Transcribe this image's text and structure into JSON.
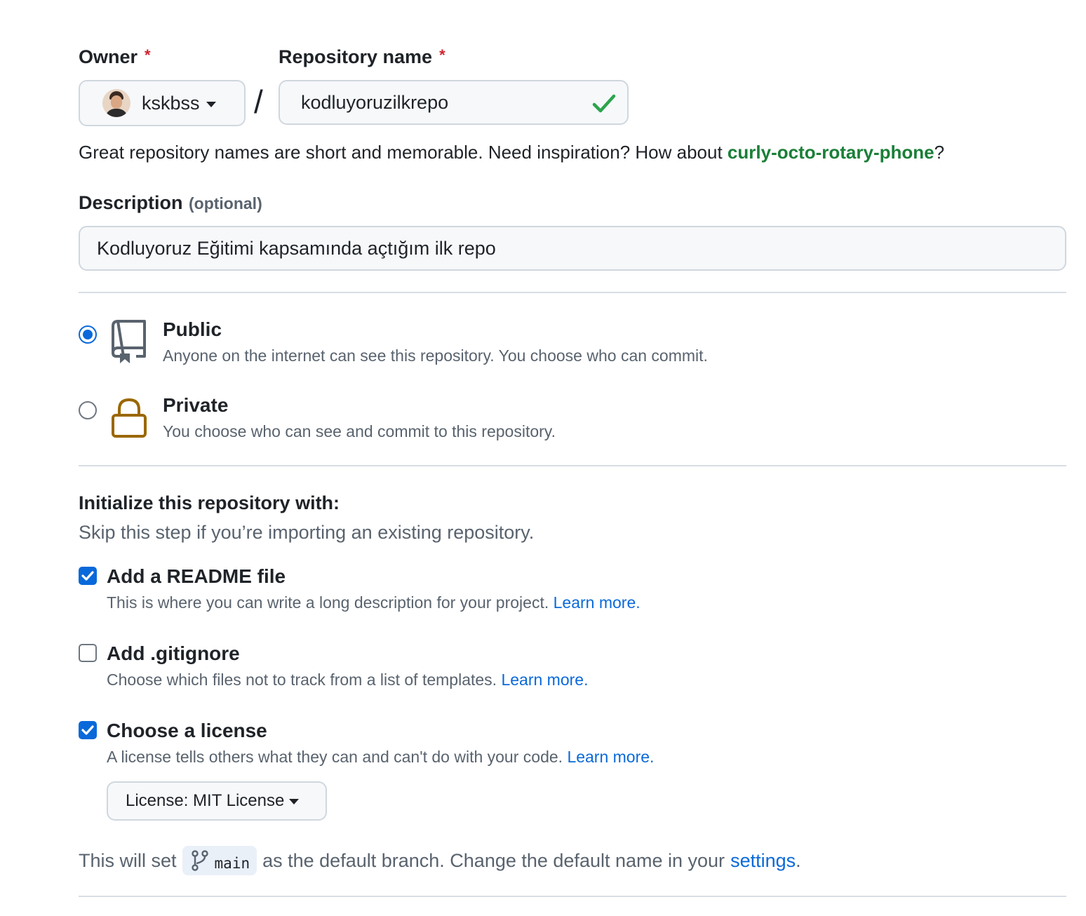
{
  "owner": {
    "label": "Owner",
    "required_mark": "*",
    "value": "kskbss",
    "avatar_icon": "user-avatar",
    "caret_icon": "caret-down-icon"
  },
  "separator": "/",
  "repo_name": {
    "label": "Repository name",
    "required_mark": "*",
    "value": "kodluyoruzilkrepo",
    "valid_icon": "check-icon",
    "valid_color": "#2da44e"
  },
  "hint": {
    "prefix": "Great repository names are short and memorable. Need inspiration? How about ",
    "suggestion": "curly-octo-rotary-phone",
    "suffix": "?"
  },
  "description": {
    "label": "Description",
    "optional": "(optional)",
    "value": "Kodluyoruz Eğitimi kapsamında açtığım ilk repo"
  },
  "visibility": {
    "selected": "public",
    "options": [
      {
        "id": "public",
        "title": "Public",
        "desc": "Anyone on the internet can see this repository. You choose who can commit.",
        "icon": "repo-icon"
      },
      {
        "id": "private",
        "title": "Private",
        "desc": "You choose who can see and commit to this repository.",
        "icon": "lock-icon",
        "icon_color": "#9a6700"
      }
    ]
  },
  "init": {
    "heading": "Initialize this repository with:",
    "subheading": "Skip this step if you’re importing an existing repository.",
    "options": [
      {
        "title": "Add a README file",
        "desc": "This is where you can write a long description for your project.",
        "link": "Learn more.",
        "checked": true
      },
      {
        "title": "Add .gitignore",
        "desc": "Choose which files not to track from a list of templates.",
        "link": "Learn more.",
        "checked": false
      },
      {
        "title": "Choose a license",
        "desc": "A license tells others what they can and can't do with your code.",
        "link": "Learn more.",
        "checked": true
      }
    ],
    "license_button": "License: MIT License"
  },
  "branch_note": {
    "prefix": "This will set",
    "branch": "main",
    "branch_icon": "git-branch-icon",
    "middle": "as the default branch. Change the default name in your",
    "link": "settings",
    "suffix": "."
  },
  "colors": {
    "accent": "#0969da",
    "danger": "#cf222e",
    "success": "#1a7f37"
  }
}
